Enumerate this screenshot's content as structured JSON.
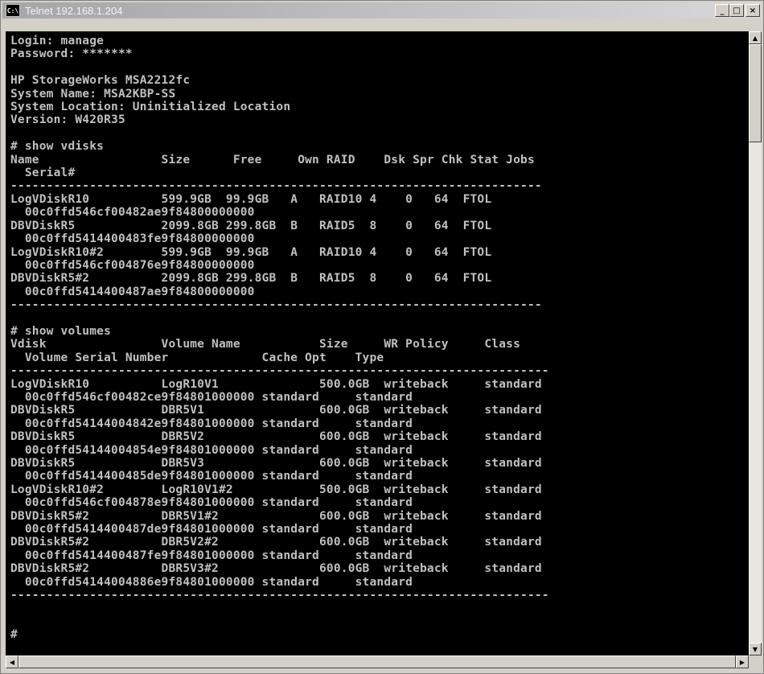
{
  "window": {
    "title": "Telnet 192.168.1.204",
    "icon_label": "C:\\",
    "buttons": {
      "minimize": "_",
      "maximize": "□",
      "close": "×"
    }
  },
  "terminal": {
    "lines": [
      "Login: manage",
      "Password: *******",
      "",
      "HP StorageWorks MSA2212fc",
      "System Name: MSA2KBP-SS",
      "System Location: Uninitialized Location",
      "Version: W420R35",
      "",
      "# show vdisks",
      "Name                 Size      Free     Own RAID    Dsk Spr Chk Stat Jobs",
      "  Serial#",
      "--------------------------------------------------------------------------",
      "LogVDiskR10          599.9GB  99.9GB   A   RAID10 4    0   64  FTOL",
      "  00c0ffd546cf00482ae9f84800000000",
      "DBVDiskR5            2099.8GB 299.8GB  B   RAID5  8    0   64  FTOL",
      "  00c0ffd5414400483fe9f84800000000",
      "LogVDiskR10#2        599.9GB  99.9GB   A   RAID10 4    0   64  FTOL",
      "  00c0ffd546cf004876e9f84800000000",
      "DBVDiskR5#2          2099.8GB 299.8GB  B   RAID5  8    0   64  FTOL",
      "  00c0ffd5414400487ae9f84800000000",
      "--------------------------------------------------------------------------",
      "",
      "# show volumes",
      "Vdisk                Volume Name           Size     WR Policy     Class",
      "  Volume Serial Number             Cache Opt    Type",
      "---------------------------------------------------------------------------",
      "LogVDiskR10          LogR10V1              500.0GB  writeback     standard",
      "  00c0ffd546cf00482ce9f84801000000 standard     standard",
      "DBVDiskR5            DBR5V1                600.0GB  writeback     standard",
      "  00c0ffd54144004842e9f84801000000 standard     standard",
      "DBVDiskR5            DBR5V2                600.0GB  writeback     standard",
      "  00c0ffd54144004854e9f84801000000 standard     standard",
      "DBVDiskR5            DBR5V3                600.0GB  writeback     standard",
      "  00c0ffd5414400485de9f84801000000 standard     standard",
      "LogVDiskR10#2        LogR10V1#2            500.0GB  writeback     standard",
      "  00c0ffd546cf004878e9f84801000000 standard     standard",
      "DBVDiskR5#2          DBR5V1#2              600.0GB  writeback     standard",
      "  00c0ffd5414400487de9f84801000000 standard     standard",
      "DBVDiskR5#2          DBR5V2#2              600.0GB  writeback     standard",
      "  00c0ffd5414400487fe9f84801000000 standard     standard",
      "DBVDiskR5#2          DBR5V3#2              600.0GB  writeback     standard",
      "  00c0ffd54144004886e9f84801000000 standard     standard",
      "---------------------------------------------------------------------------",
      "",
      "",
      "#"
    ]
  },
  "scrollbars": {
    "up_arrow": "▲",
    "down_arrow": "▼",
    "left_arrow": "◀",
    "right_arrow": "▶"
  }
}
